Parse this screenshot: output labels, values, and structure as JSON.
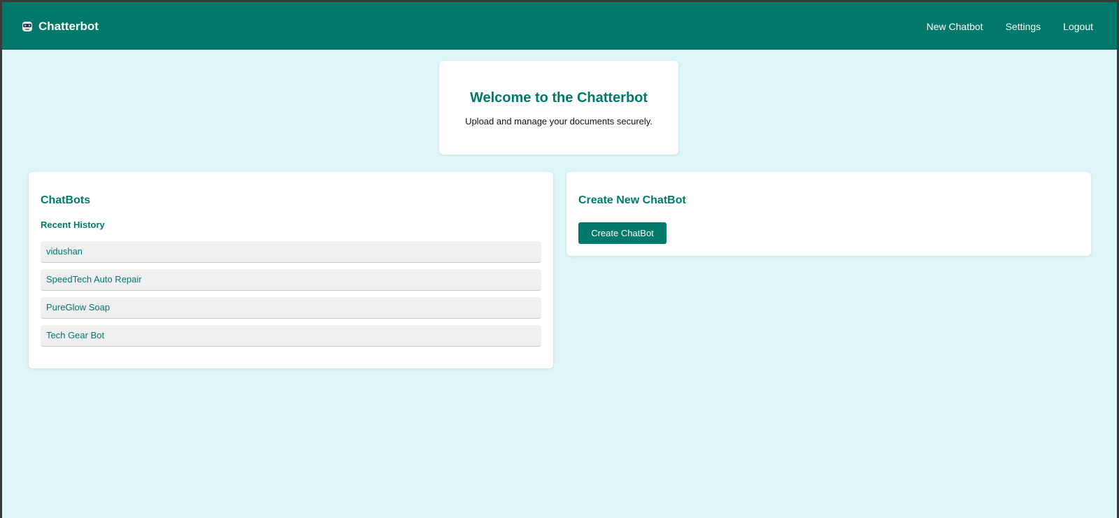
{
  "navbar": {
    "brand": "Chatterbot",
    "brand_icon": "robot-icon",
    "links": [
      "New Chatbot",
      "Settings",
      "Logout"
    ]
  },
  "welcome": {
    "title": "Welcome to the Chatterbot",
    "subtitle": "Upload and manage your documents securely."
  },
  "chatbots": {
    "title": "ChatBots",
    "recent_label": "Recent History",
    "items": [
      "vidushan",
      "SpeedTech Auto Repair",
      "PureGlow Soap",
      "Tech Gear Bot"
    ]
  },
  "create": {
    "title": "Create New ChatBot",
    "button_label": "Create ChatBot"
  },
  "colors": {
    "primary": "#00796b",
    "background": "#dff6f8",
    "card": "#ffffff",
    "list_item": "#efefef"
  }
}
